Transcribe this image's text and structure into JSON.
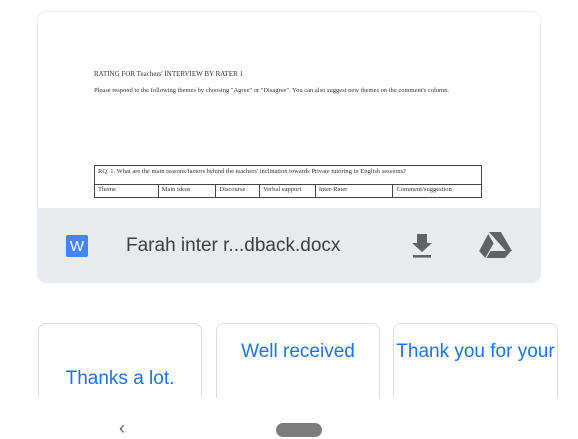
{
  "attachment": {
    "preview": {
      "title": "RATING FOR Teachers' INTERVIEW BY RATER 1",
      "instructions": "Please respond to the following themes by choosing \"Agree\" or \"Disagree\". You can also suggest new themes on the comment's column.",
      "table": {
        "question": "RQ. 1.  What are the main reasons/factors behind the teachers' inclination towards Private tutoring in English sessions?",
        "columns": [
          "Theme",
          "Main ideas",
          "Discourse",
          "Verbal support",
          "Inter-Rater",
          "Comment/suggestion"
        ]
      }
    },
    "file_icon_letter": "W",
    "file_name": "Farah inter r...dback.docx",
    "icons": {
      "file_type": "word-doc-icon",
      "download": "download-icon",
      "drive": "google-drive-icon"
    },
    "colors": {
      "word_blue": "#4285f4",
      "bar_background": "#e8eaed"
    }
  },
  "smart_replies": [
    {
      "label": "Thanks a lot."
    },
    {
      "label": "Well received"
    },
    {
      "label": "Thank you for your"
    }
  ],
  "nav": {
    "back_glyph": "‹",
    "icons": {
      "back": "back-chevron-icon",
      "home": "home-pill"
    }
  },
  "accent_color": "#1a73e8"
}
